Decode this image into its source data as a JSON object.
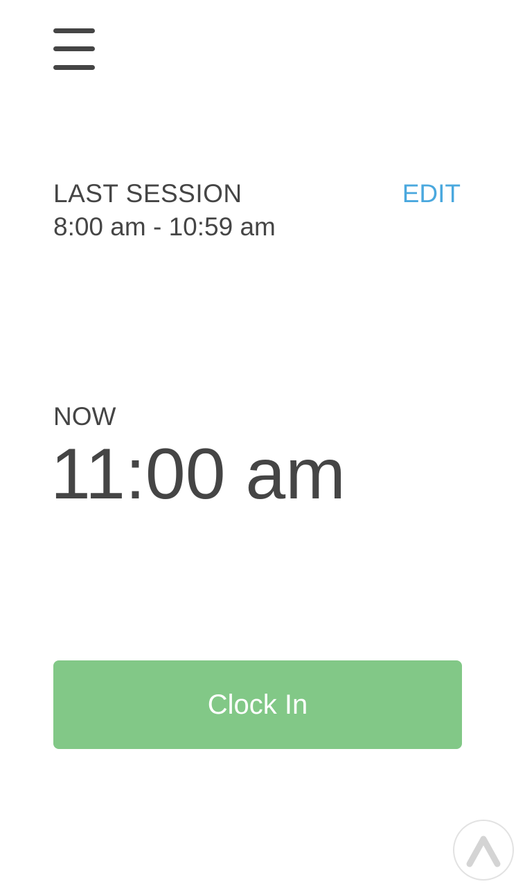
{
  "header": {
    "menu_icon": "hamburger-menu-icon"
  },
  "last_session": {
    "label": "LAST SESSION",
    "range": "8:00 am - 10:59 am",
    "edit_label": "EDIT"
  },
  "now": {
    "label": "NOW",
    "time": "11:00 am"
  },
  "actions": {
    "clock_in_label": "Clock In",
    "scroll_top_icon": "chevron-up-icon"
  },
  "colors": {
    "text": "#454545",
    "accent_link": "#4aa8de",
    "clock_in_button": "#82c887",
    "background": "#ffffff"
  }
}
